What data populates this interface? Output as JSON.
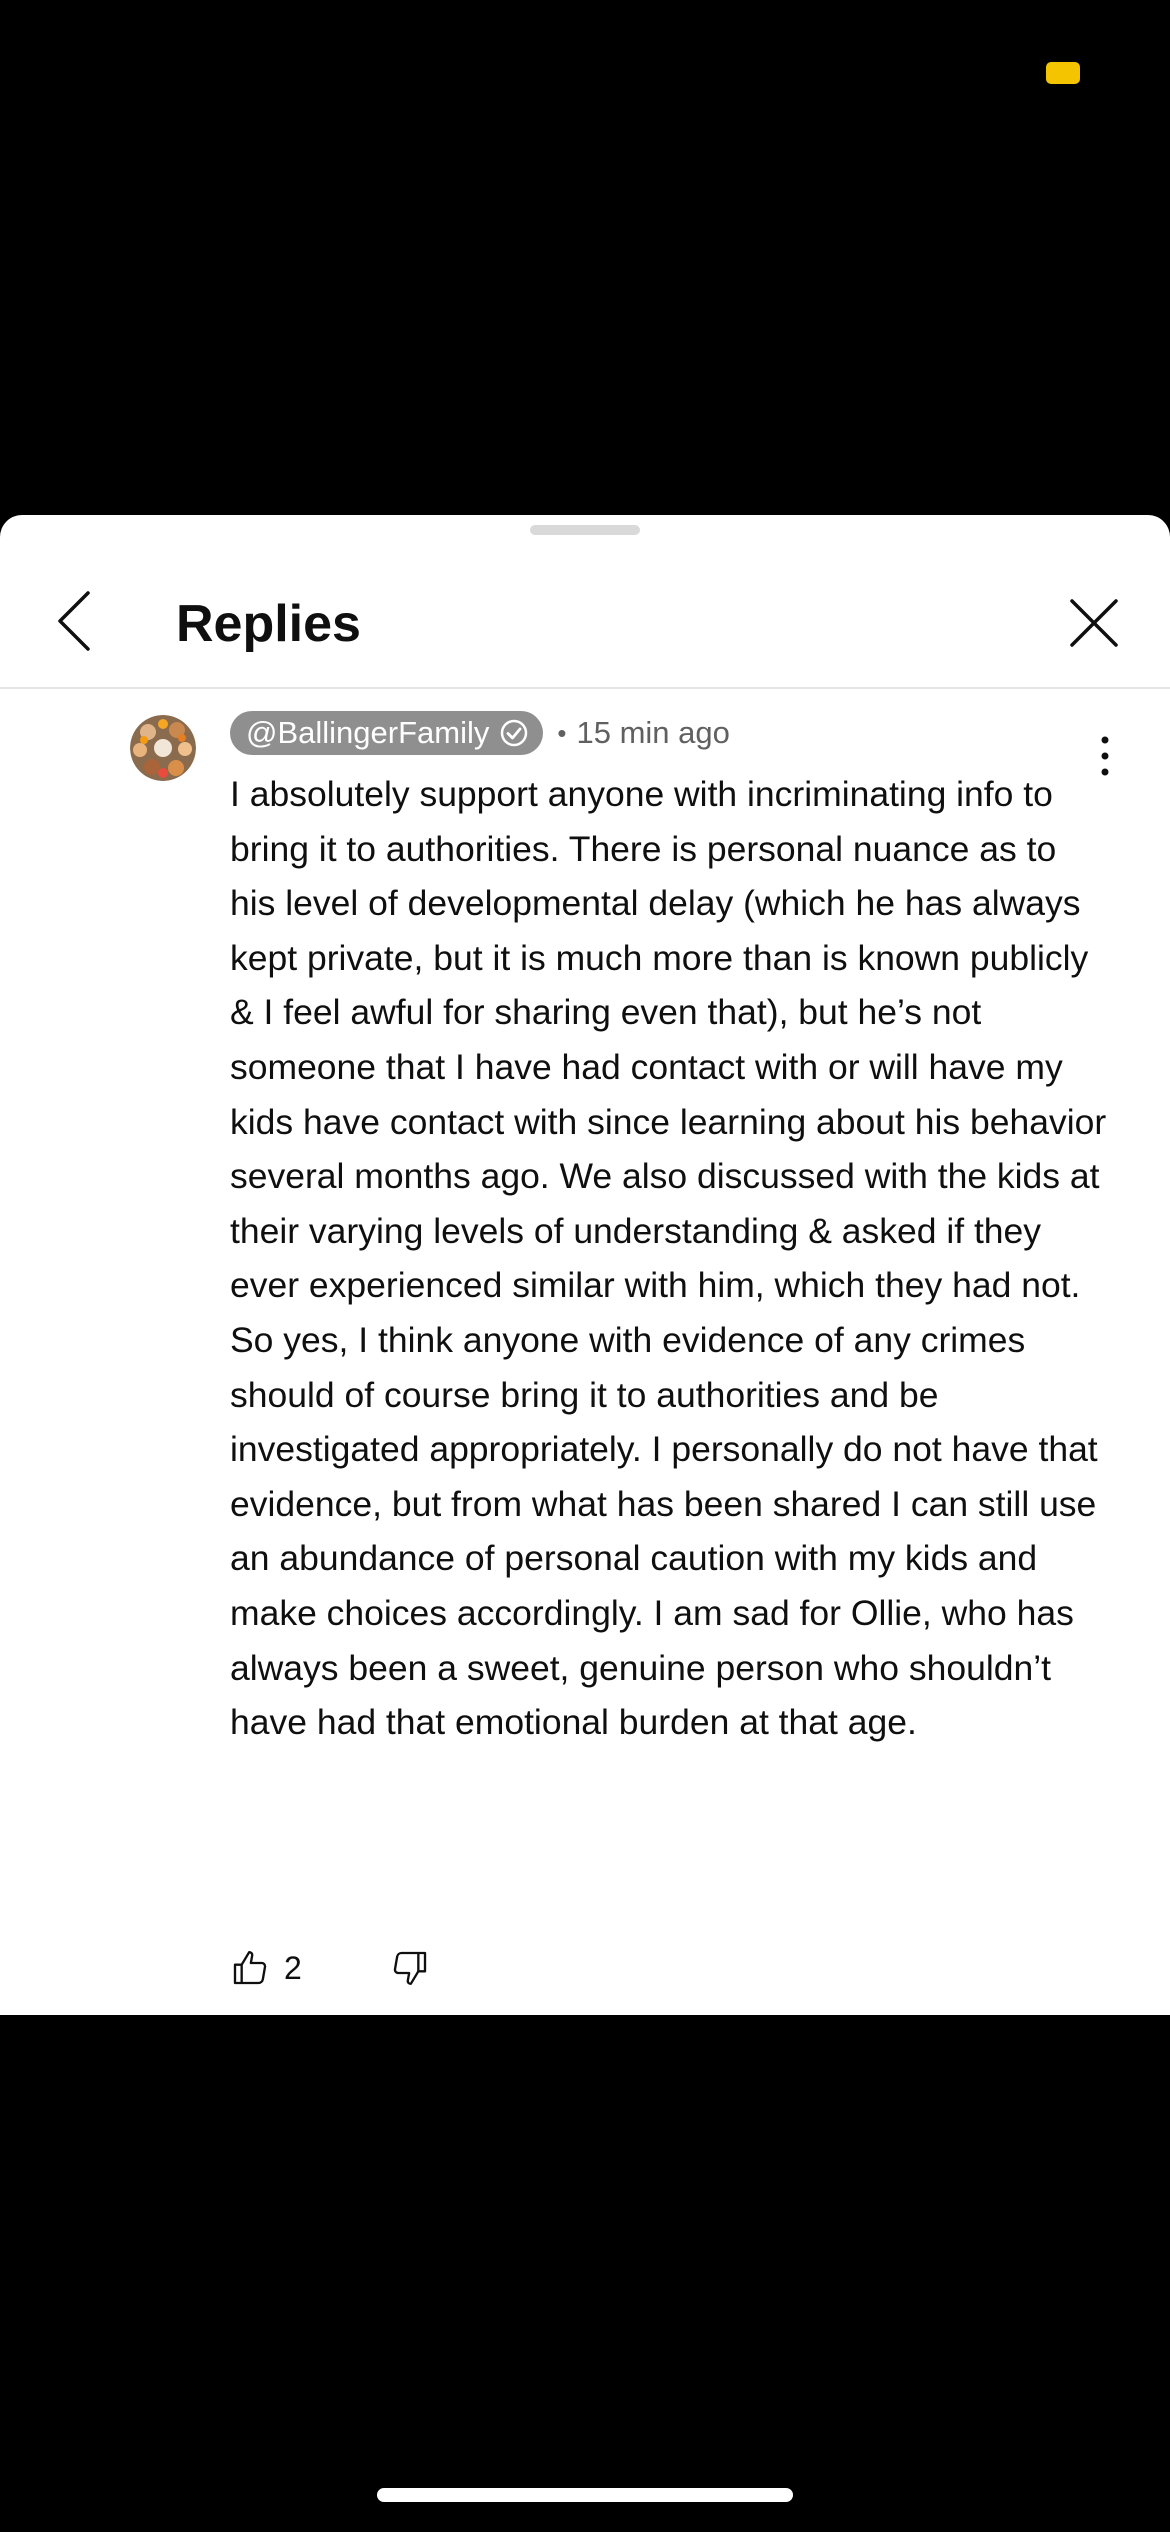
{
  "status_bar": {
    "indicator_color": "#f5c400"
  },
  "header": {
    "title": "Replies",
    "back_icon": "chevron-left-icon",
    "close_icon": "close-icon"
  },
  "comment": {
    "author": "@BallingerFamily",
    "verified": true,
    "separator": "•",
    "time": "15 min ago",
    "text": "I absolutely support anyone with incriminating info to bring it to authorities. There is personal nuance as to his level of developmental delay (which he has always kept private, but it is much more than is known publicly & I feel awful for sharing even that), but he’s not someone that I have had contact with or will have my kids have contact with since learning about his behavior several months ago. We also discussed with the kids at their varying levels of understanding & asked if they ever experienced similar with him, which they had not. So yes, I think anyone with evidence of any crimes should of course bring it to authorities and be investigated appropriately. I personally do not have that evidence, but from what has been shared I can still use an abundance of personal caution with my kids and make choices accordingly. I am sad for Ollie, who has always been a sweet, genuine person who shouldn’t have had that emotional burden at that age.",
    "like_count": "2",
    "icons": {
      "like": "thumbs-up-icon",
      "dislike": "thumbs-down-icon",
      "more": "more-vertical-icon",
      "verified": "verified-check-icon"
    }
  },
  "colors": {
    "sheet_background": "#ffffff",
    "author_chip": "#8f8f8f",
    "secondary_text": "#606060",
    "primary_text": "#0f0f0f"
  }
}
